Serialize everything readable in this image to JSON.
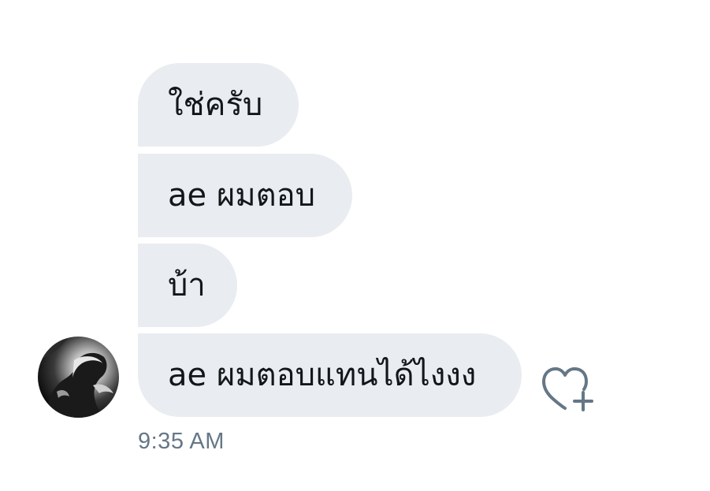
{
  "conversation": {
    "messages": [
      {
        "text": "ใช่ครับ"
      },
      {
        "text": "ae ผมตอบ"
      },
      {
        "text": "บ้า"
      },
      {
        "text": "ae ผมตอบแทนได้ไงงง"
      }
    ],
    "timestamp": "9:35 AM"
  },
  "icons": {
    "avatar": "avatar",
    "like": "heart-plus-icon"
  },
  "colors": {
    "bubble_background": "#e9ecf0",
    "message_text": "#14171a",
    "timestamp_text": "#657786",
    "icon_stroke": "#657786"
  }
}
